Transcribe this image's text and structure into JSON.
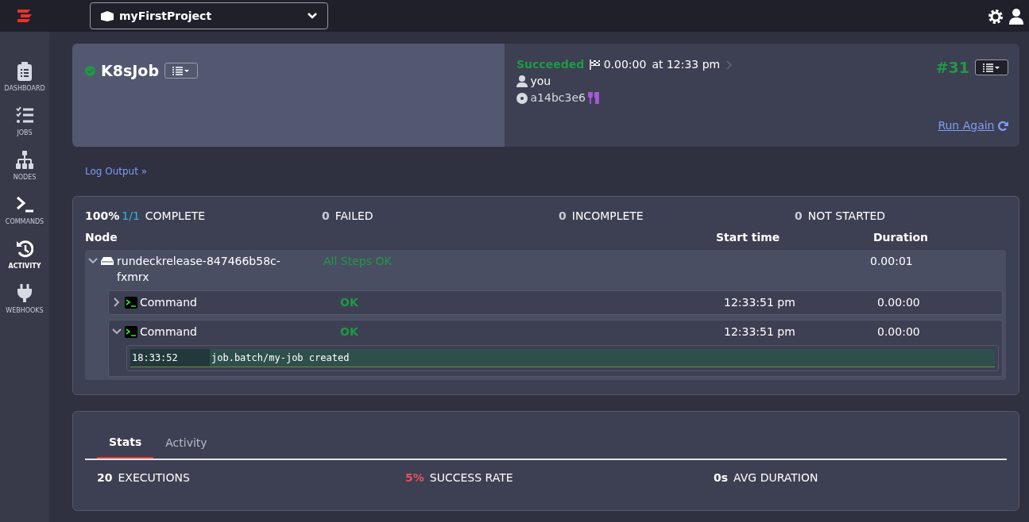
{
  "topbar": {
    "project": "myFirstProject"
  },
  "sidebar": {
    "items": [
      {
        "label": "DASHBOARD",
        "kind": "clipboard",
        "selected": false
      },
      {
        "label": "JOBS",
        "kind": "checklist",
        "selected": false
      },
      {
        "label": "NODES",
        "kind": "sitemap",
        "selected": false
      },
      {
        "label": "COMMANDS",
        "kind": "terminal",
        "selected": false
      },
      {
        "label": "ACTIVITY",
        "kind": "history",
        "selected": true
      },
      {
        "label": "WEBHOOKS",
        "kind": "plug",
        "selected": false
      }
    ]
  },
  "job": {
    "name": "K8sJob",
    "succeeded": true
  },
  "execution": {
    "status": "Succeeded",
    "duration": "0.00:00",
    "time": "at 12:33 pm",
    "user": "you",
    "node_id": "a14bc3e6",
    "number": "#31",
    "run_again": "Run Again"
  },
  "log_link": "Log Output »",
  "summary": [
    {
      "value": "100%",
      "extra": "1/1",
      "label": "COMPLETE"
    },
    {
      "value": "0",
      "label": "FAILED"
    },
    {
      "value": "0",
      "label": "INCOMPLETE"
    },
    {
      "value": "0",
      "label": "NOT STARTED"
    }
  ],
  "columns": [
    "Node",
    "Start time",
    "Duration"
  ],
  "node": {
    "name": "rundeckrelease-847466b58c-fxmrx",
    "expanded": true,
    "status": "All Steps OK",
    "duration": "0.00:01",
    "steps": [
      {
        "name": "Command",
        "status": "OK",
        "start": "12:33:51 pm",
        "duration": "0.00:00",
        "expanded": false
      },
      {
        "name": "Command",
        "status": "OK",
        "start": "12:33:51 pm",
        "duration": "0.00:00",
        "expanded": true,
        "log": [
          {
            "time": "18:33:52",
            "text": "job.batch/my-job created"
          }
        ]
      }
    ]
  },
  "stats": {
    "tabs": [
      {
        "label": "Stats",
        "selected": true
      },
      {
        "label": "Activity",
        "selected": false
      }
    ],
    "items": [
      {
        "value": "20",
        "label": "EXECUTIONS",
        "kind": "plain"
      },
      {
        "value": "5%",
        "label": "SUCCESS RATE",
        "kind": "alert"
      },
      {
        "value": "0s",
        "label": "AVG DURATION",
        "kind": "plain"
      }
    ]
  }
}
